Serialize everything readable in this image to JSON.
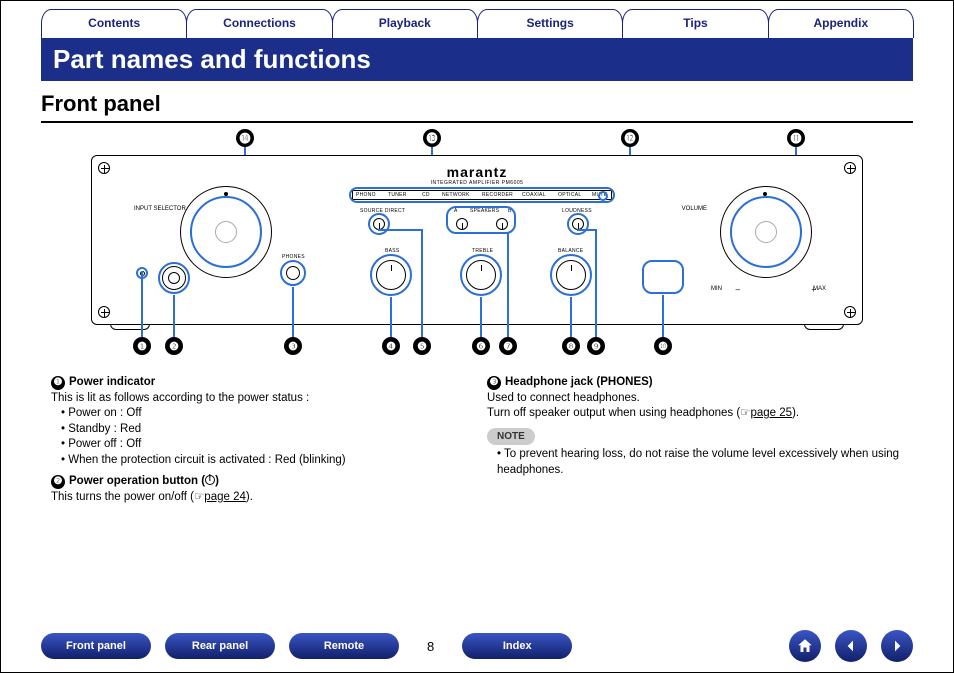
{
  "tabs": [
    "Contents",
    "Connections",
    "Playback",
    "Settings",
    "Tips",
    "Appendix"
  ],
  "title": "Part names and functions",
  "section": "Front panel",
  "brand": "marantz",
  "subbrand": "INTEGRATED AMPLIFIER PM6005",
  "panel_labels": {
    "input_selector": "INPUT SELECTOR",
    "volume": "VOLUME",
    "min": "MIN",
    "max": "MAX",
    "phones": "PHONES",
    "source_direct": "SOURCE DIRECT",
    "speakers_a": "A",
    "speakers": "SPEAKERS",
    "speakers_b": "B",
    "loudness": "LOUDNESS",
    "bass": "BASS",
    "treble": "TREBLE",
    "balance": "BALANCE",
    "sources": [
      "PHONO",
      "TUNER",
      "CD",
      "NETWORK",
      "RECORDER",
      "COAXIAL",
      "OPTICAL",
      "MUTE"
    ]
  },
  "callouts_top": {
    "14": "⓮",
    "13": "⓭",
    "12": "⓬",
    "11": "⓫"
  },
  "callouts_bottom": {
    "1": "❶",
    "2": "❷",
    "3": "❸",
    "4": "❹",
    "5": "❺",
    "6": "❻",
    "7": "❼",
    "8": "❽",
    "9": "❾",
    "10": "❿"
  },
  "desc": {
    "d1": {
      "num": "❶",
      "title": "Power indicator",
      "line": "This is lit as follows according to the power status :",
      "b1": "Power on : Off",
      "b2": "Standby : Red",
      "b3": "Power off : Off",
      "b4": "When the protection circuit is activated : Red (blinking)"
    },
    "d2": {
      "num": "❷",
      "title": "Power operation button (",
      "title_end": ")",
      "line_a": "This turns the power on/off (",
      "page": "page 24",
      "line_b": ")."
    },
    "d3": {
      "num": "❸",
      "title": "Headphone jack (PHONES)",
      "l1": "Used to connect headphones.",
      "l2a": "Turn off speaker output when using headphones (",
      "page": "page 25",
      "l2b": ").",
      "note_label": "NOTE",
      "note": "To prevent hearing loss, do not raise the volume level excessively when using headphones."
    }
  },
  "bottom_nav": {
    "front": "Front panel",
    "rear": "Rear panel",
    "remote": "Remote",
    "index": "Index",
    "page": "8"
  }
}
